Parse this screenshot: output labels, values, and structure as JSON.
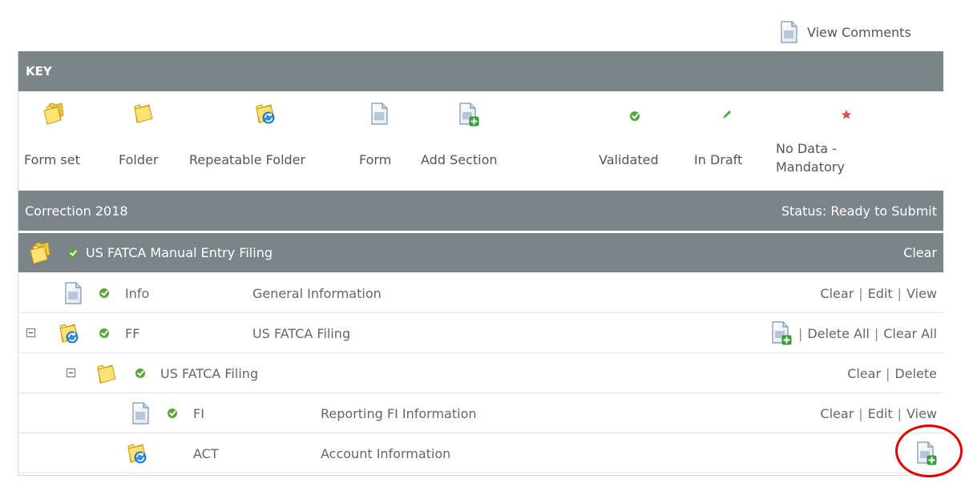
{
  "view_comments": {
    "label": "View Comments",
    "icon": "form-doc-icon"
  },
  "key": {
    "title": "KEY",
    "items": [
      {
        "label": "Form set",
        "icon": "form-set-icon"
      },
      {
        "label": "Folder",
        "icon": "folder-icon"
      },
      {
        "label": "Repeatable Folder",
        "icon": "repeatable-folder-icon"
      },
      {
        "label": "Form",
        "icon": "form-icon"
      },
      {
        "label": "Add Section",
        "icon": "add-section-icon"
      },
      {
        "label": "Validated",
        "icon": "validated-icon"
      },
      {
        "label": "In Draft",
        "icon": "in-draft-icon"
      },
      {
        "label": "No Data -",
        "label2": "Mandatory",
        "icon": "no-data-mandatory-icon"
      }
    ]
  },
  "section": {
    "title": "Correction 2018",
    "status": "Status: Ready to Submit"
  },
  "filing": {
    "title": "US FATCA Manual Entry Filing",
    "action": "Clear"
  },
  "rows": [
    {
      "code": "Info",
      "desc": "General Information",
      "actions": [
        "Clear",
        "Edit",
        "View"
      ]
    },
    {
      "code": "FF",
      "desc": "US FATCA Filing",
      "actions": [
        "Delete All",
        "Clear All"
      ]
    },
    {
      "code": "US FATCA Filing",
      "desc": "",
      "actions": [
        "Clear",
        "Delete"
      ]
    },
    {
      "code": "FI",
      "desc": "Reporting FI Information",
      "actions": [
        "Clear",
        "Edit",
        "View"
      ]
    },
    {
      "code": "ACT",
      "desc": "Account Information",
      "actions": []
    }
  ],
  "colors": {
    "header_bg": "#7b8489",
    "validated": "#5aa63a",
    "highlight": "#e00000"
  }
}
